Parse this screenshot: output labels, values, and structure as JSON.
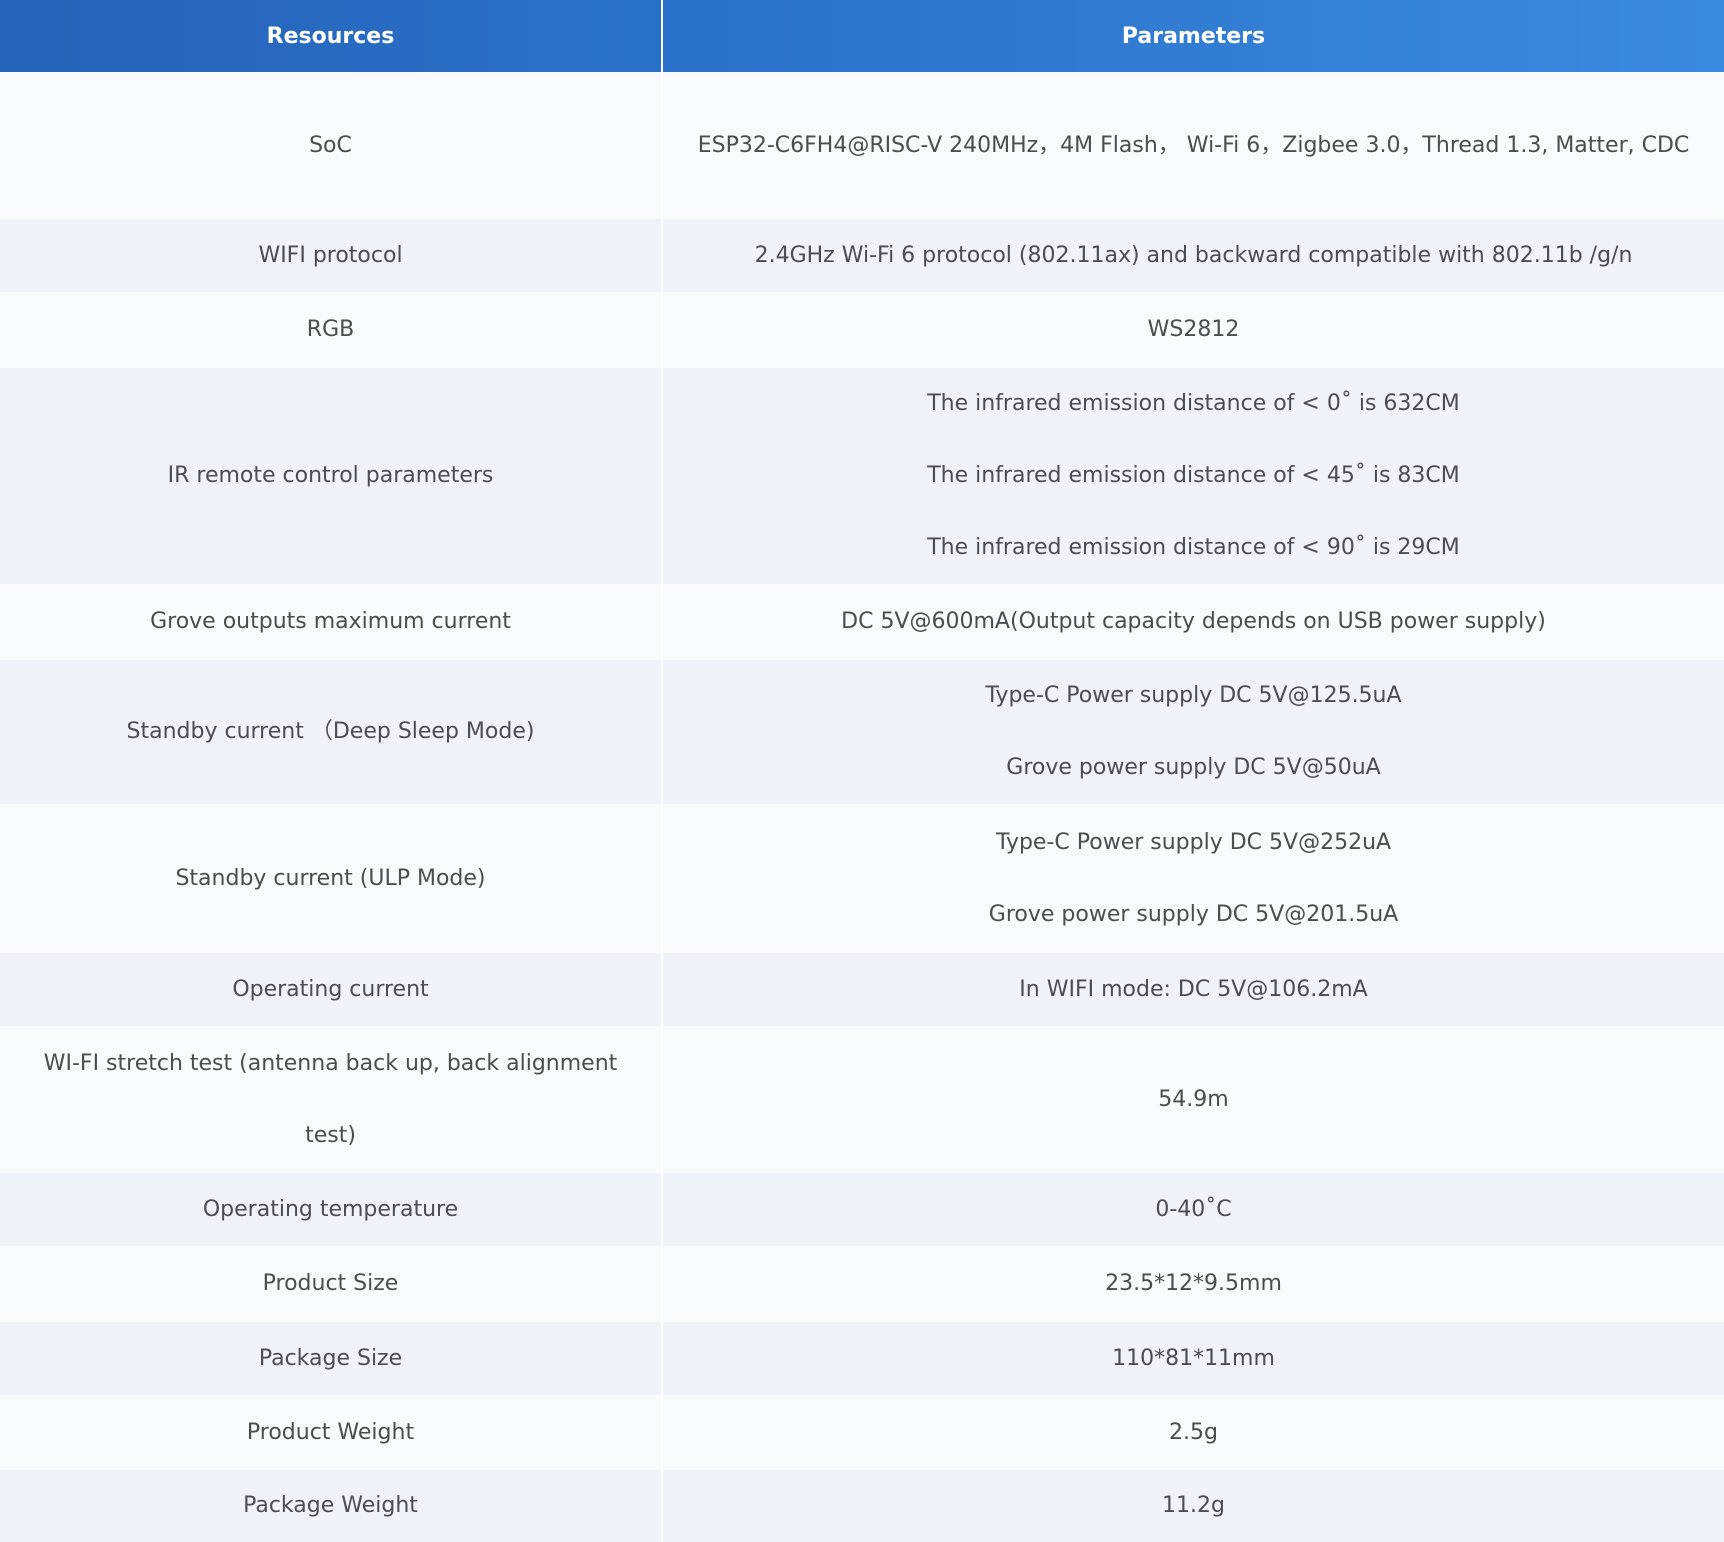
{
  "table": {
    "headers": [
      "Resources",
      "Parameters"
    ],
    "rows": [
      {
        "resource": "SoC",
        "params": [
          "ESP32-C6FH4@RISC-V 240MHz，4M Flash， Wi-Fi 6，Zigbee 3.0，Thread 1.3, Matter, CDC"
        ],
        "h": 147
      },
      {
        "resource": "WIFI protocol",
        "params": [
          "2.4GHz Wi-Fi 6 protocol (802.11ax) and backward compatible with 802.11b /g/n"
        ],
        "h": 73
      },
      {
        "resource": "RGB",
        "params": [
          "WS2812"
        ],
        "h": 76
      },
      {
        "resource": "IR remote control parameters",
        "params": [
          "The infrared emission distance of < 0˚ is 632CM",
          "The infrared emission distance of < 45˚ is 83CM",
          "The infrared emission distance of < 90˚ is 29CM"
        ],
        "h": 216
      },
      {
        "resource": "Grove outputs maximum current",
        "params": [
          "DC 5V@600mA(Output capacity depends on USB power supply)"
        ],
        "h": 76
      },
      {
        "resource": "Standby current （Deep Sleep Mode)",
        "params": [
          "Type-C Power supply DC 5V@125.5uA",
          "Grove power supply DC 5V@50uA"
        ],
        "h": 143
      },
      {
        "resource": "Standby current (ULP Mode)",
        "params": [
          "Type-C Power supply DC 5V@252uA",
          "Grove power supply DC 5V@201.5uA"
        ],
        "h": 149
      },
      {
        "resource": "Operating current",
        "params": [
          "In WIFI mode: DC 5V@106.2mA"
        ],
        "h": 73
      },
      {
        "resource": "WI-FI stretch test (antenna back up, back alignment test)",
        "params": [
          "54.9m"
        ],
        "h": 147
      },
      {
        "resource": "Operating temperature",
        "params": [
          "0-40˚C"
        ],
        "h": 73
      },
      {
        "resource": "Product Size",
        "params": [
          "23.5*12*9.5mm"
        ],
        "h": 76
      },
      {
        "resource": "Package Size",
        "params": [
          "110*81*11mm"
        ],
        "h": 73
      },
      {
        "resource": "Product Weight",
        "params": [
          "2.5g"
        ],
        "h": 75
      },
      {
        "resource": "Package Weight",
        "params": [
          "11.2g"
        ],
        "h": 71
      }
    ]
  }
}
